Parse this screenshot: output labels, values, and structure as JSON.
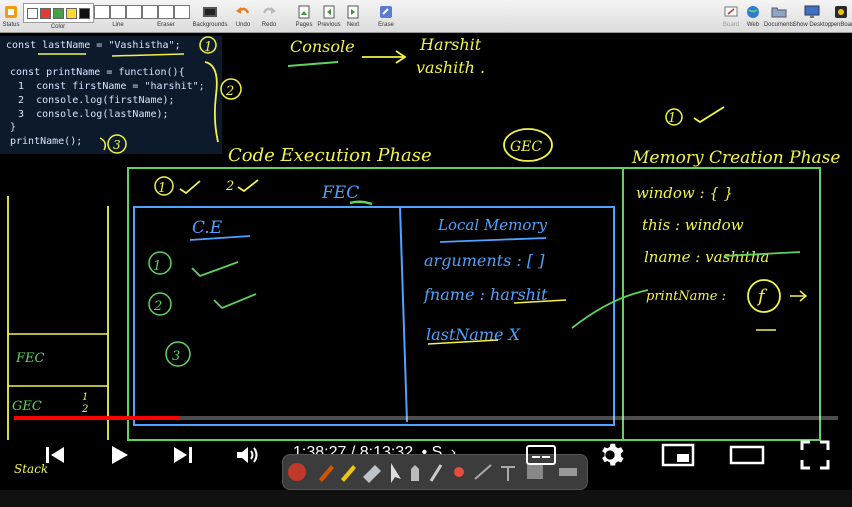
{
  "toolbar": {
    "groups": [
      {
        "label": "Status"
      },
      {
        "label": "Color"
      },
      {
        "label": "Line"
      },
      {
        "label": "Eraser"
      },
      {
        "label": "Backgrounds"
      },
      {
        "label": "Undo"
      },
      {
        "label": "Redo"
      },
      {
        "label": "Pages"
      },
      {
        "label": "Previous"
      },
      {
        "label": "Next"
      },
      {
        "label": "Erase"
      }
    ],
    "right": [
      {
        "label": "Board"
      },
      {
        "label": "Web"
      },
      {
        "label": "Documents"
      },
      {
        "label": "Show Desktop"
      },
      {
        "label": "OpenBoard"
      }
    ],
    "colors": [
      "#ffffff",
      "#e53935",
      "#43a047",
      "#fdd835",
      "#111111"
    ]
  },
  "code": {
    "lines": [
      "const lastName = \"Vashistha\";",
      "",
      "const printName = function(){",
      "  1  const firstName = \"harshit\";",
      "  2  console.log(firstName);",
      "  3  console.log(lastName);",
      "}",
      "printName();"
    ]
  },
  "annotations": {
    "console_label": "Console",
    "console_out_1": "Harshit",
    "console_out_2": "vashith .",
    "code_exec_phase": "Code Execution Phase",
    "gec": "GEC",
    "memory_creation_phase": "Memory Creation Phase",
    "fec": "FEC",
    "ce": "C.E",
    "local_memory": "Local Memory",
    "arguments": "arguments : [  ]",
    "fname": "fname : harshit",
    "lastname": "lastName  X",
    "window": "window : {  }",
    "this": "this : window",
    "lname": "lname : vashitha",
    "printname": "printName :",
    "f_circle": "f",
    "step_1": "1",
    "step_2": "2",
    "step_3": "3",
    "stack_fec": "FEC",
    "stack_gec": "GEC",
    "stack_label": "Stack"
  },
  "player": {
    "time": "1:38:27 / 8:13:32",
    "chapter": "• S",
    "progress_fraction": 0.2
  },
  "colors": {
    "ink_yellow": "#f2f24a",
    "ink_green": "#5fd35f",
    "ink_blue": "#4da3ff",
    "progress": "#ff0000"
  }
}
